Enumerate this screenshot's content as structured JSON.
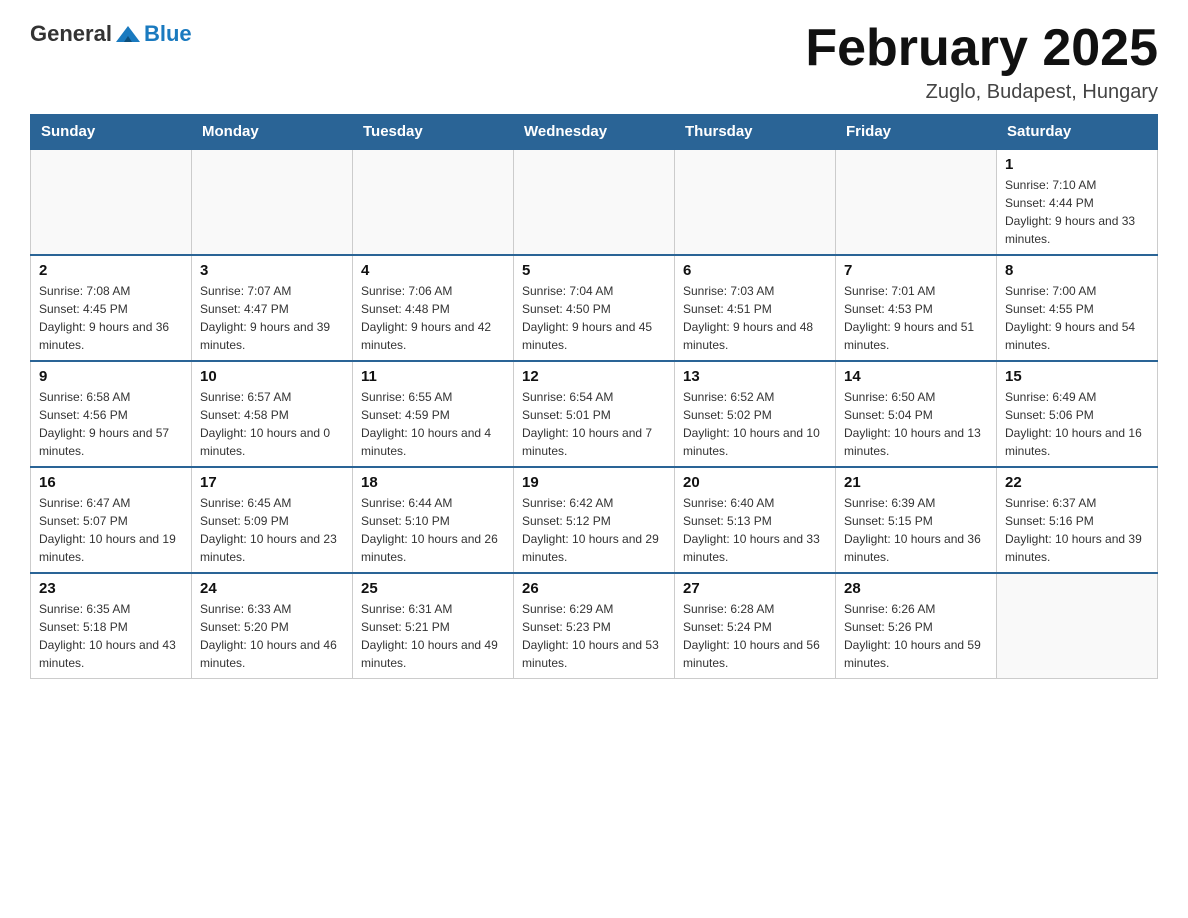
{
  "header": {
    "logo_general": "General",
    "logo_blue": "Blue",
    "month_title": "February 2025",
    "location": "Zuglo, Budapest, Hungary"
  },
  "weekdays": [
    "Sunday",
    "Monday",
    "Tuesday",
    "Wednesday",
    "Thursday",
    "Friday",
    "Saturday"
  ],
  "weeks": [
    [
      {
        "day": "",
        "info": ""
      },
      {
        "day": "",
        "info": ""
      },
      {
        "day": "",
        "info": ""
      },
      {
        "day": "",
        "info": ""
      },
      {
        "day": "",
        "info": ""
      },
      {
        "day": "",
        "info": ""
      },
      {
        "day": "1",
        "info": "Sunrise: 7:10 AM\nSunset: 4:44 PM\nDaylight: 9 hours and 33 minutes."
      }
    ],
    [
      {
        "day": "2",
        "info": "Sunrise: 7:08 AM\nSunset: 4:45 PM\nDaylight: 9 hours and 36 minutes."
      },
      {
        "day": "3",
        "info": "Sunrise: 7:07 AM\nSunset: 4:47 PM\nDaylight: 9 hours and 39 minutes."
      },
      {
        "day": "4",
        "info": "Sunrise: 7:06 AM\nSunset: 4:48 PM\nDaylight: 9 hours and 42 minutes."
      },
      {
        "day": "5",
        "info": "Sunrise: 7:04 AM\nSunset: 4:50 PM\nDaylight: 9 hours and 45 minutes."
      },
      {
        "day": "6",
        "info": "Sunrise: 7:03 AM\nSunset: 4:51 PM\nDaylight: 9 hours and 48 minutes."
      },
      {
        "day": "7",
        "info": "Sunrise: 7:01 AM\nSunset: 4:53 PM\nDaylight: 9 hours and 51 minutes."
      },
      {
        "day": "8",
        "info": "Sunrise: 7:00 AM\nSunset: 4:55 PM\nDaylight: 9 hours and 54 minutes."
      }
    ],
    [
      {
        "day": "9",
        "info": "Sunrise: 6:58 AM\nSunset: 4:56 PM\nDaylight: 9 hours and 57 minutes."
      },
      {
        "day": "10",
        "info": "Sunrise: 6:57 AM\nSunset: 4:58 PM\nDaylight: 10 hours and 0 minutes."
      },
      {
        "day": "11",
        "info": "Sunrise: 6:55 AM\nSunset: 4:59 PM\nDaylight: 10 hours and 4 minutes."
      },
      {
        "day": "12",
        "info": "Sunrise: 6:54 AM\nSunset: 5:01 PM\nDaylight: 10 hours and 7 minutes."
      },
      {
        "day": "13",
        "info": "Sunrise: 6:52 AM\nSunset: 5:02 PM\nDaylight: 10 hours and 10 minutes."
      },
      {
        "day": "14",
        "info": "Sunrise: 6:50 AM\nSunset: 5:04 PM\nDaylight: 10 hours and 13 minutes."
      },
      {
        "day": "15",
        "info": "Sunrise: 6:49 AM\nSunset: 5:06 PM\nDaylight: 10 hours and 16 minutes."
      }
    ],
    [
      {
        "day": "16",
        "info": "Sunrise: 6:47 AM\nSunset: 5:07 PM\nDaylight: 10 hours and 19 minutes."
      },
      {
        "day": "17",
        "info": "Sunrise: 6:45 AM\nSunset: 5:09 PM\nDaylight: 10 hours and 23 minutes."
      },
      {
        "day": "18",
        "info": "Sunrise: 6:44 AM\nSunset: 5:10 PM\nDaylight: 10 hours and 26 minutes."
      },
      {
        "day": "19",
        "info": "Sunrise: 6:42 AM\nSunset: 5:12 PM\nDaylight: 10 hours and 29 minutes."
      },
      {
        "day": "20",
        "info": "Sunrise: 6:40 AM\nSunset: 5:13 PM\nDaylight: 10 hours and 33 minutes."
      },
      {
        "day": "21",
        "info": "Sunrise: 6:39 AM\nSunset: 5:15 PM\nDaylight: 10 hours and 36 minutes."
      },
      {
        "day": "22",
        "info": "Sunrise: 6:37 AM\nSunset: 5:16 PM\nDaylight: 10 hours and 39 minutes."
      }
    ],
    [
      {
        "day": "23",
        "info": "Sunrise: 6:35 AM\nSunset: 5:18 PM\nDaylight: 10 hours and 43 minutes."
      },
      {
        "day": "24",
        "info": "Sunrise: 6:33 AM\nSunset: 5:20 PM\nDaylight: 10 hours and 46 minutes."
      },
      {
        "day": "25",
        "info": "Sunrise: 6:31 AM\nSunset: 5:21 PM\nDaylight: 10 hours and 49 minutes."
      },
      {
        "day": "26",
        "info": "Sunrise: 6:29 AM\nSunset: 5:23 PM\nDaylight: 10 hours and 53 minutes."
      },
      {
        "day": "27",
        "info": "Sunrise: 6:28 AM\nSunset: 5:24 PM\nDaylight: 10 hours and 56 minutes."
      },
      {
        "day": "28",
        "info": "Sunrise: 6:26 AM\nSunset: 5:26 PM\nDaylight: 10 hours and 59 minutes."
      },
      {
        "day": "",
        "info": ""
      }
    ]
  ]
}
